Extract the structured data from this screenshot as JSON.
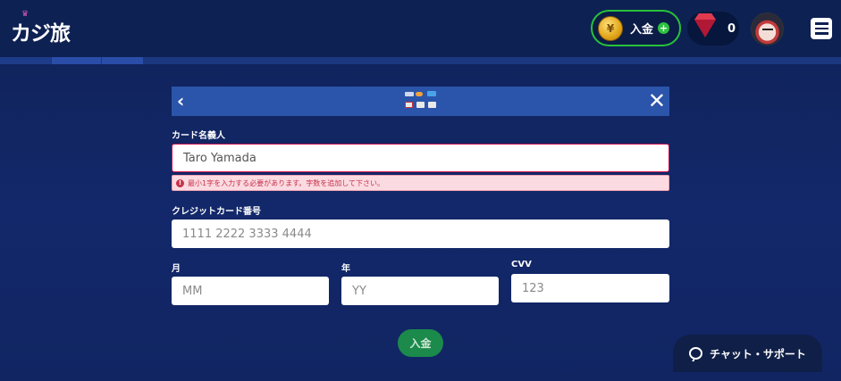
{
  "header": {
    "logo_text": "カジ旅",
    "deposit_label": "入金",
    "gem_count": "0",
    "colors": {
      "deposit_border": "#27c23a",
      "header_bg": "#0e2153"
    }
  },
  "panel": {
    "icons": {
      "back": "chevron-left-icon",
      "close": "close-icon",
      "cards": "card-brands-icon"
    }
  },
  "form": {
    "cardholder_label": "カード名義人",
    "cardholder_value": "Taro Yamada",
    "error_message": "最小1字を入力する必要があります。字数を追加して下さい。",
    "card_number_label": "クレジットカード番号",
    "card_number_placeholder": "1111 2222 3333 4444",
    "month_label": "月",
    "month_placeholder": "MM",
    "year_label": "年",
    "year_placeholder": "YY",
    "cvv_label": "CVV",
    "cvv_placeholder": "123",
    "submit_label": "入金"
  },
  "chat": {
    "label": "チャット・サポート"
  }
}
